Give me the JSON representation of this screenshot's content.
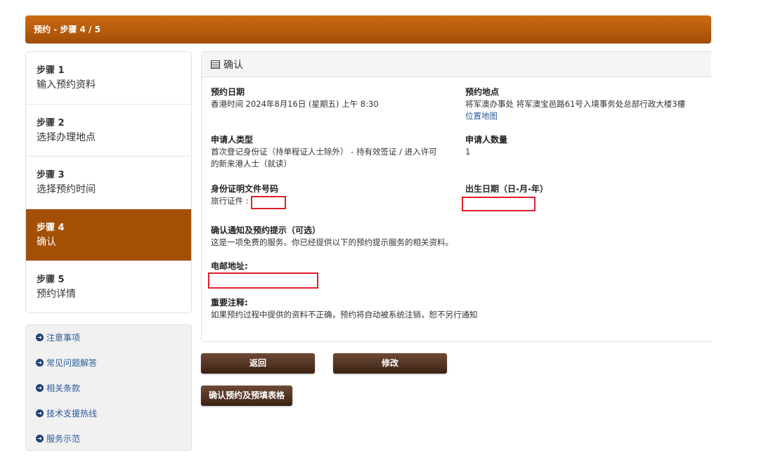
{
  "header": {
    "title": "预约 - 步骤 4 / 5"
  },
  "steps": [
    {
      "num": "步骤 1",
      "label": "输入预约资料",
      "active": false
    },
    {
      "num": "步骤 2",
      "label": "选择办理地点",
      "active": false
    },
    {
      "num": "步骤 3",
      "label": "选择预约时间",
      "active": false
    },
    {
      "num": "步骤 4",
      "label": "确认",
      "active": true
    },
    {
      "num": "步骤 5",
      "label": "预约详情",
      "active": false
    }
  ],
  "links": [
    {
      "label": "注意事项"
    },
    {
      "label": "常见问题解答"
    },
    {
      "label": "相关条款"
    },
    {
      "label": "技术支援热线"
    },
    {
      "label": "服务示范"
    }
  ],
  "panel": {
    "title": "确认",
    "date_label": "预约日期",
    "date_value": "香港时间 2024年8月16日 (星期五) 上午 8:30",
    "location_label": "预约地点",
    "location_value": "将军澳办事处 将军澳宝邑路61号入境事务处总部行政大楼3樓",
    "location_map": "位置地图",
    "applicant_type_label": "申请人类型",
    "applicant_type_line1": "首次登记身份证（持单程证人士除外） - 持有效签证 / 进入许可",
    "applicant_type_line2": "的新来港人士（就读）",
    "applicant_count_label": "申请人数量",
    "applicant_count_value": "1",
    "id_doc_label": "身份证明文件号码",
    "id_doc_value": "旅行证件 :",
    "dob_label": "出生日期（日-月-年）",
    "notify_label": "确认通知及预约提示（可选）",
    "notify_value": "这是一项免费的服务。你已经提供以下的预约提示服务的相关资料。",
    "email_label": "电邮地址:",
    "important_label": "重要注释:",
    "important_value": "如果预约过程中提供的资料不正确，预约将自动被系统注销，恕不另行通知"
  },
  "buttons": {
    "back": "返回",
    "modify": "修改",
    "confirm": "确认预约及预填表格"
  },
  "colors": {
    "header": "#b85c0a",
    "active_step": "#a44f06",
    "button": "#4e3020",
    "link": "#2a5a9a",
    "redaction": "#e0202a"
  }
}
